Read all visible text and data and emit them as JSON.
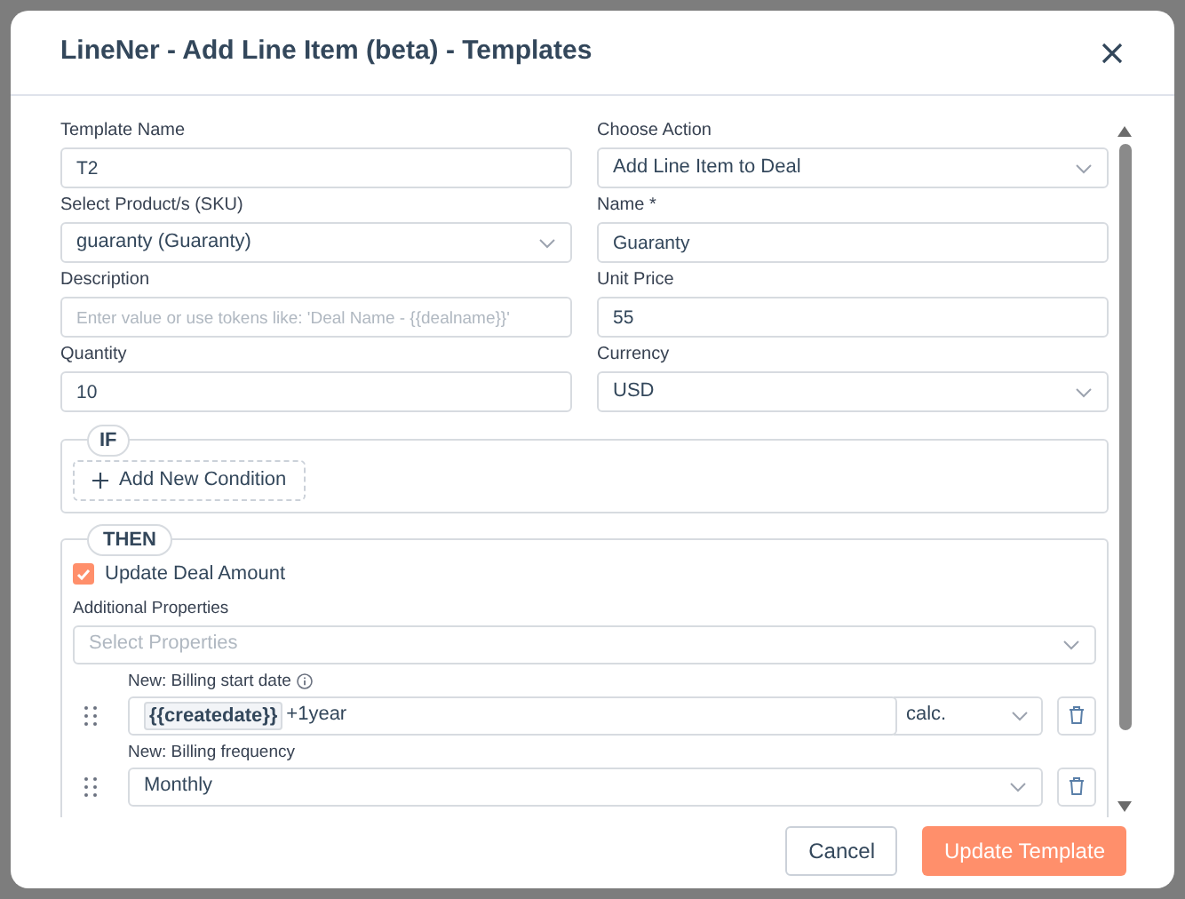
{
  "dialog": {
    "title": "LineNer - Add Line Item (beta) - Templates"
  },
  "fields": [
    {
      "label": "Template Name",
      "kind": "text",
      "value": "T2"
    },
    {
      "label": "Choose Action",
      "kind": "select",
      "value": "Add Line Item to Deal"
    },
    {
      "label": "Select Product/s (SKU)",
      "kind": "select",
      "value": "guaranty (Guaranty)"
    },
    {
      "label": "Name *",
      "kind": "text",
      "value": "Guaranty"
    },
    {
      "label": "Description",
      "kind": "text",
      "placeholder": "Enter value or use tokens like: 'Deal Name - {{dealname}}'"
    },
    {
      "label": "Unit Price",
      "kind": "text",
      "value": "55"
    },
    {
      "label": "Quantity",
      "kind": "text",
      "value": "10"
    },
    {
      "label": "Currency",
      "kind": "select",
      "value": "USD"
    }
  ],
  "if_section": {
    "label": "IF",
    "add_button": "Add New Condition"
  },
  "then_section": {
    "label": "THEN",
    "checkbox": {
      "label": "Update Deal Amount",
      "checked": true
    },
    "additional_properties": {
      "label": "Additional Properties",
      "placeholder": "Select Properties"
    },
    "properties": [
      {
        "label": "New: Billing start date",
        "info": true,
        "kind": "token",
        "token": "{{createdate}}",
        "value": "+1year",
        "mode": "calc."
      },
      {
        "label": "New: Billing frequency",
        "info": false,
        "kind": "select",
        "value": "Monthly"
      }
    ]
  },
  "buttons": [
    {
      "label": "Cancel",
      "kind": "secondary"
    },
    {
      "label": "Update Template",
      "kind": "primary"
    }
  ]
}
